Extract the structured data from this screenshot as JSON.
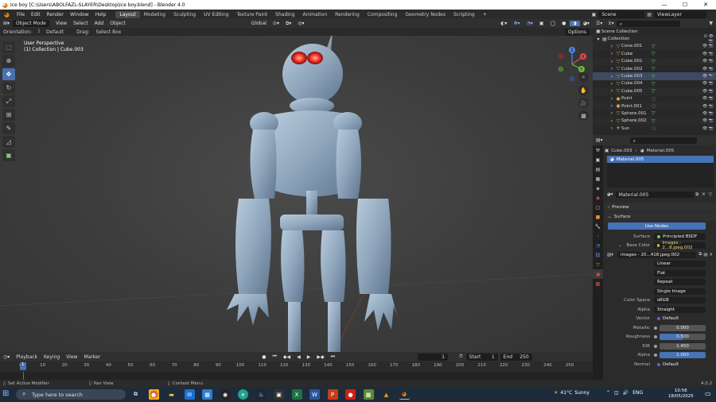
{
  "window": {
    "title": "Ice boy [C:\\Users\\ABOLFAZL-SLAYER\\Desktop\\Ice boy.blend] - Blender 4.0",
    "minimize": "—",
    "maximize": "☐",
    "close": "✕"
  },
  "menu": {
    "items": [
      "File",
      "Edit",
      "Render",
      "Window",
      "Help"
    ],
    "workspaces": [
      "Layout",
      "Modeling",
      "Sculpting",
      "UV Editing",
      "Texture Paint",
      "Shading",
      "Animation",
      "Rendering",
      "Compositing",
      "Geometry Nodes",
      "Scripting"
    ],
    "active_workspace": "Layout",
    "add_tab": "+",
    "scene": "Scene",
    "view_layer": "ViewLayer"
  },
  "viewport_header": {
    "mode": "Object Mode",
    "menus": [
      "View",
      "Select",
      "Add",
      "Object"
    ],
    "orientation_label": "Orientation:",
    "orientation": "Default",
    "drag_label": "Drag:",
    "drag": "Select Box",
    "transform": "Global",
    "options": "Options"
  },
  "viewport": {
    "perspective": "User Perspective",
    "collection_info": "(1) Collection | Cube.003"
  },
  "tools": [
    "select-box",
    "cursor",
    "move",
    "rotate",
    "scale",
    "transform",
    "annotate",
    "measure",
    "add-cube"
  ],
  "active_tool": "move",
  "nav_gizmo": {
    "x": "X",
    "y": "Y",
    "z": "Z"
  },
  "outliner": {
    "search_placeholder": "",
    "scene_collection": "Scene Collection",
    "collection": "Collection",
    "items": [
      {
        "name": "Cone.001",
        "icon": "▽",
        "modifier": true
      },
      {
        "name": "Cube",
        "icon": "▽",
        "modifier": true
      },
      {
        "name": "Cube.001",
        "icon": "▽",
        "modifier": true
      },
      {
        "name": "Cube.002",
        "icon": "▽",
        "modifier": true
      },
      {
        "name": "Cube.003",
        "icon": "▽",
        "modifier": true
      },
      {
        "name": "Cube.004",
        "icon": "▽",
        "modifier": true
      },
      {
        "name": "Cube.005",
        "icon": "▽",
        "modifier": true
      },
      {
        "name": "Point",
        "icon": "◉",
        "modifier": false
      },
      {
        "name": "Point.001",
        "icon": "◉",
        "modifier": false
      },
      {
        "name": "Sphere.001",
        "icon": "▽",
        "modifier": true
      },
      {
        "name": "Sphere.002",
        "icon": "▽",
        "modifier": true
      },
      {
        "name": "Sun",
        "icon": "☀",
        "modifier": false
      }
    ]
  },
  "properties": {
    "object": "Cube.003",
    "material_breadcrumb": "Material.005",
    "slot": "Material.005",
    "material_name": "Material.005",
    "preview_section": "Preview",
    "surface_section": "Surface",
    "use_nodes": "Use Nodes",
    "surface_label": "Surface",
    "surface_value": "Principled BSDF",
    "base_color_label": "Base Color",
    "base_color_value": "Images - 2...8.jpeg.002",
    "image_name": "images - 20...418.jpeg.002",
    "interpolation": "Linear",
    "projection": "Flat",
    "extension": "Repeat",
    "source": "Single Image",
    "color_space_label": "Color Space",
    "color_space": "sRGB",
    "alpha_label": "Alpha",
    "alpha_mode": "Straight",
    "vector_label": "Vector",
    "vector_value": "Default",
    "metallic_label": "Metallic",
    "metallic_value": "0.000",
    "roughness_label": "Roughness",
    "roughness_value": "0.500",
    "roughness_fraction": 0.5,
    "ior_label": "IOR",
    "ior_value": "1.450",
    "alpha2_label": "Alpha",
    "alpha2_value": "1.000",
    "normal_label": "Normal",
    "normal_value": "Default"
  },
  "timeline": {
    "menus": [
      "Playback",
      "Keying",
      "View",
      "Marker"
    ],
    "current_frame": "1",
    "start_label": "Start",
    "start": "1",
    "end_label": "End",
    "end": "250",
    "ticks": [
      "0",
      "10",
      "20",
      "30",
      "40",
      "50",
      "60",
      "70",
      "80",
      "90",
      "100",
      "110",
      "120",
      "130",
      "140",
      "150",
      "160",
      "170",
      "180",
      "190",
      "200",
      "210",
      "220",
      "230",
      "240",
      "250"
    ],
    "playhead": "1"
  },
  "statusbar": {
    "left": "Set Active Modifier",
    "middle": "Pan View",
    "right": "Context Menu",
    "version": "4.0.2"
  },
  "taskbar": {
    "search_placeholder": "Type here to search",
    "weather_temp": "41°C",
    "weather_text": "Sunny",
    "language": "ENG",
    "time": "10:56",
    "date": "18/05/2025"
  },
  "colors": {
    "accent": "#4772b3",
    "header": "#303030",
    "panel": "#2b2b2b",
    "ice": "#9fb4c8"
  }
}
